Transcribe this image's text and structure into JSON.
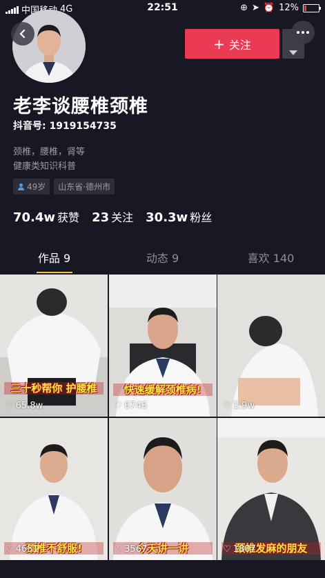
{
  "status_bar": {
    "carrier": "中国移动",
    "network": "4G",
    "time": "22:51",
    "battery": "12%",
    "battery_color": "#e5413b"
  },
  "header": {
    "back_icon": "chevron-left-icon",
    "follow_label": "关注",
    "follow_icon": "plus-icon",
    "menu_icon": "more-dots-icon",
    "dropdown_icon": "caret-down-icon"
  },
  "profile": {
    "name": "老李谈腰椎颈椎",
    "douyin_id": "抖音号: 1919154735",
    "bio_line1": "颈椎，腰椎，肾等",
    "bio_line2": "健康类知识科普",
    "tag_age": "49岁",
    "tag_location": "山东省·德州市"
  },
  "stats": {
    "likes_value": "70.4w",
    "likes_label": "获赞",
    "following_value": "23",
    "following_label": "关注",
    "fans_value": "30.3w",
    "fans_label": "粉丝"
  },
  "tabs": [
    {
      "label": "作品 9"
    },
    {
      "label": "动态 9"
    },
    {
      "label": "喜欢 140"
    }
  ],
  "videos": [
    {
      "caption": "三十秒帮你 护腰椎",
      "likes": "65.8w"
    },
    {
      "caption": "快速缓解颈椎病!",
      "likes": "6746"
    },
    {
      "caption": "",
      "likes": "1.9w"
    },
    {
      "caption": "颈椎不舒服!",
      "likes": "4651"
    },
    {
      "caption": "今天讲一讲",
      "likes": "3567"
    },
    {
      "caption": "颈椎发麻的朋友",
      "likes": "1807"
    }
  ],
  "colors": {
    "accent": "#ea3a54",
    "tab_indicator": "#f5c52d",
    "background": "#171823"
  }
}
